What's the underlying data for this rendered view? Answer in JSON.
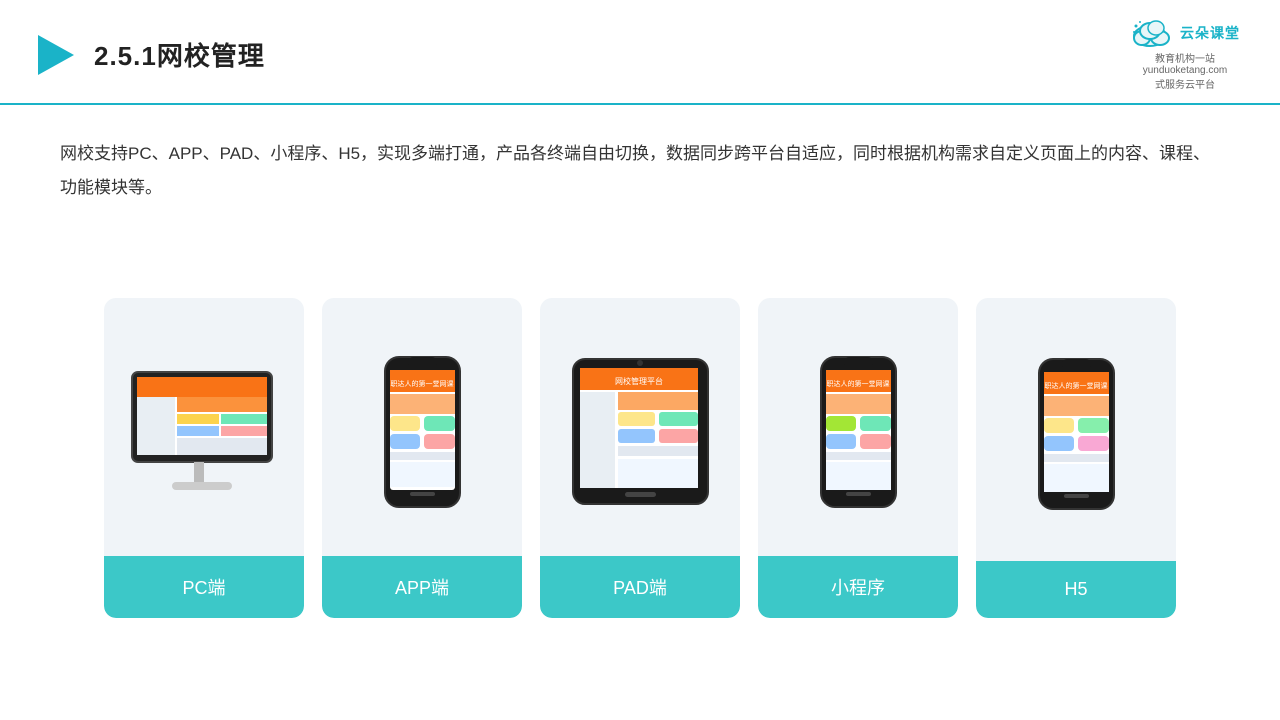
{
  "header": {
    "title": "2.5.1网校管理",
    "brand_name": "云朵课堂",
    "brand_url": "yunduoketang.com",
    "brand_sub1": "教育机构一站",
    "brand_sub2": "式服务云平台"
  },
  "description": {
    "text": "网校支持PC、APP、PAD、小程序、H5，实现多端打通，产品各终端自由切换，数据同步跨平台自适应，同时根据机构需求自定义页面上的内容、课程、功能模块等。"
  },
  "cards": [
    {
      "id": "pc",
      "label": "PC端",
      "type": "pc"
    },
    {
      "id": "app",
      "label": "APP端",
      "type": "phone"
    },
    {
      "id": "pad",
      "label": "PAD端",
      "type": "tablet"
    },
    {
      "id": "miniapp",
      "label": "小程序",
      "type": "phone"
    },
    {
      "id": "h5",
      "label": "H5",
      "type": "phone"
    }
  ],
  "colors": {
    "accent": "#1ab3c8",
    "card_bg": "#eef2f7",
    "label_bg": "#3cc8c0",
    "border": "#1ab3c8"
  }
}
